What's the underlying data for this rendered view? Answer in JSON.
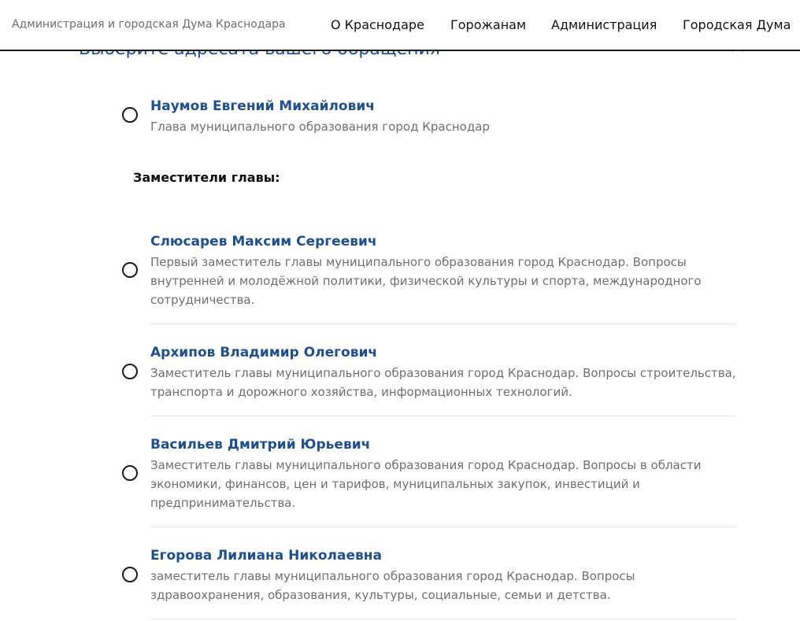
{
  "header": {
    "site_title": "Администрация и городская Дума Краснодара",
    "nav": [
      {
        "label": "О Краснодаре"
      },
      {
        "label": "Горожанам"
      },
      {
        "label": "Администрация"
      },
      {
        "label": "Городская Дума"
      }
    ]
  },
  "section": {
    "title": "Выберите адресата вашего обращения",
    "toggle_icon": "chevron-up-icon"
  },
  "head_person": {
    "name": "Наумов Евгений Михайлович",
    "position": "Глава муниципального образования город Краснодар",
    "selected": false
  },
  "deputies_heading": "Заместители главы:",
  "deputies": [
    {
      "name": "Слюсарев Максим Сергеевич",
      "position": "Первый заместитель главы муниципального образования город Краснодар. Вопросы внутренней и молодёжной политики, физической культуры и спорта, международного сотрудничества.",
      "selected": false
    },
    {
      "name": "Архипов Владимир Олегович",
      "position": "Заместитель главы муниципального образования город Краснодар. Вопросы строительства, транспорта и дорожного хозяйства, информационных технологий.",
      "selected": false
    },
    {
      "name": "Васильев Дмитрий Юрьевич",
      "position": "Заместитель главы муниципального образования город Краснодар. Вопросы в области экономики, финансов, цен и тарифов, муниципальных закупок, инвестиций и предпринимательства.",
      "selected": false
    },
    {
      "name": "Егорова Лилиана Николаевна",
      "position": "заместитель главы муниципального образования город Краснодар. Вопросы здравоохранения, образования, культуры, социальные, семьи и детства.",
      "selected": false
    }
  ]
}
